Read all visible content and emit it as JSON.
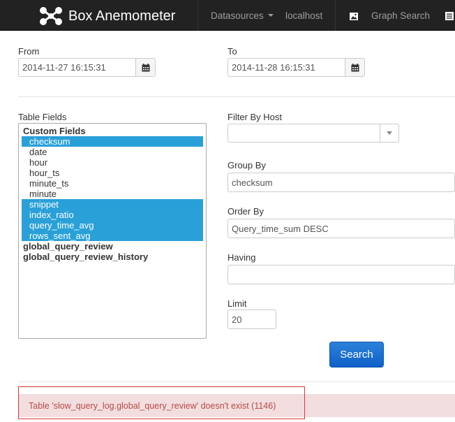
{
  "navbar": {
    "brand": "Box Anemometer",
    "datasources": "Datasources",
    "host": "localhost",
    "graph_search": "Graph Search",
    "icons": [
      "hub-logo-icon",
      "picture-icon",
      "list-icon"
    ]
  },
  "date_range": {
    "from_label": "From",
    "from_value": "2014-11-27 16:15:31",
    "to_label": "To",
    "to_value": "2014-11-28 16:15:31",
    "icon": "calendar-icon"
  },
  "table_fields": {
    "label": "Table Fields",
    "options": [
      {
        "text": "Custom Fields",
        "type": "group",
        "selected": false
      },
      {
        "text": "checksum",
        "type": "child",
        "selected": true
      },
      {
        "text": "date",
        "type": "child",
        "selected": false
      },
      {
        "text": "hour",
        "type": "child",
        "selected": false
      },
      {
        "text": "hour_ts",
        "type": "child",
        "selected": false
      },
      {
        "text": "minute_ts",
        "type": "child",
        "selected": false
      },
      {
        "text": "minute",
        "type": "child",
        "selected": false
      },
      {
        "text": "snippet",
        "type": "child",
        "selected": true
      },
      {
        "text": "index_ratio",
        "type": "child",
        "selected": true
      },
      {
        "text": "query_time_avg",
        "type": "child",
        "selected": true
      },
      {
        "text": "rows_sent_avg",
        "type": "child",
        "selected": true
      },
      {
        "text": "global_query_review",
        "type": "group",
        "selected": false
      },
      {
        "text": "global_query_review_history",
        "type": "group",
        "selected": false
      }
    ]
  },
  "filter_by_host": {
    "label": "Filter By Host",
    "value": ""
  },
  "group_by": {
    "label": "Group By",
    "value": "checksum"
  },
  "order_by": {
    "label": "Order By",
    "value": "Query_time_sum DESC"
  },
  "having": {
    "label": "Having",
    "value": ""
  },
  "limit": {
    "label": "Limit",
    "value": "20"
  },
  "search_button": "Search",
  "alert": {
    "message": "Table 'slow_query_log.global_query_review' doesn't exist (1146)",
    "colors": {
      "background": "#f2dede",
      "text": "#b94a48",
      "outline": "#dd3333"
    }
  }
}
